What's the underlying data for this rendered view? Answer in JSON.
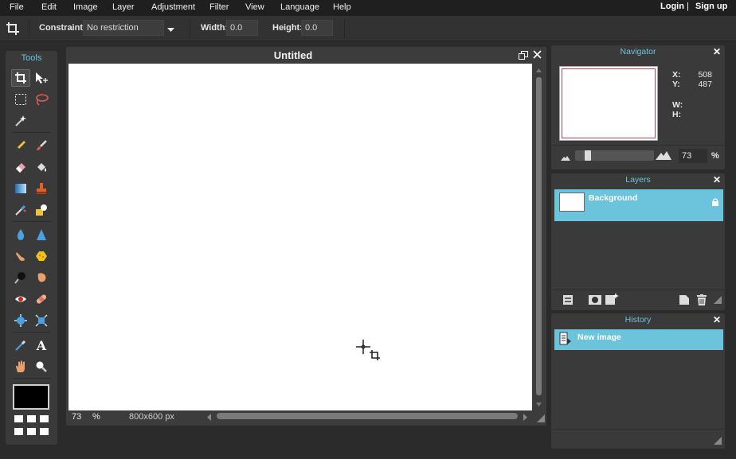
{
  "menu": {
    "items": [
      "File",
      "Edit",
      "Image",
      "Layer",
      "Adjustment",
      "Filter",
      "View",
      "Language",
      "Help"
    ],
    "login": "Login",
    "divider": "|",
    "signup": "Sign up"
  },
  "options": {
    "constraint_label": "Constraint:",
    "constraint_value": "No restriction",
    "width_label": "Width:",
    "width_value": "0.0",
    "height_label": "Height:",
    "height_value": "0.0"
  },
  "tools": {
    "title": "Tools",
    "foreground_color": "#000000"
  },
  "canvas": {
    "title": "Untitled",
    "zoom": "73",
    "zoom_unit": "%",
    "dimensions": "800x600 px"
  },
  "navigator": {
    "title": "Navigator",
    "x_label": "X:",
    "x_value": "508",
    "y_label": "Y:",
    "y_value": "487",
    "w_label": "W:",
    "h_label": "H:",
    "zoom_value": "73",
    "zoom_unit": "%"
  },
  "layers": {
    "title": "Layers",
    "items": [
      {
        "name": "Background",
        "locked": true
      }
    ]
  },
  "history": {
    "title": "History",
    "items": [
      "New image"
    ]
  },
  "colors": {
    "accent": "#6cc3dc",
    "bg": "#2b2b2b",
    "panel": "#3a3a3a"
  }
}
